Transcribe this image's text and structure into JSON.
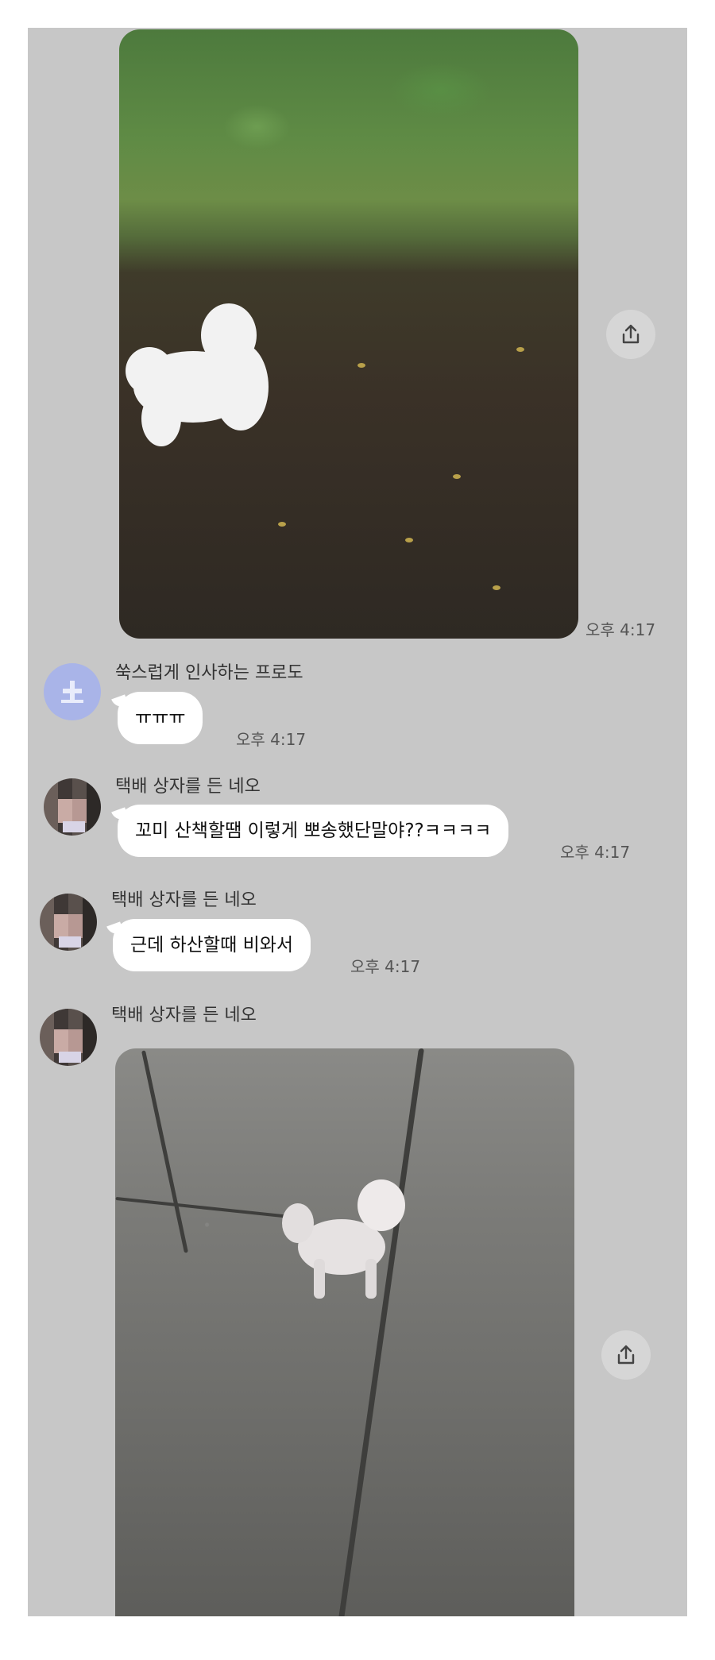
{
  "messages": [
    {
      "type": "photo",
      "time": "오후 4:17"
    },
    {
      "type": "text",
      "sender": "쑥스럽게 인사하는 프로도",
      "text": "ㅠㅠㅠ",
      "time": "오후 4:17"
    },
    {
      "type": "text",
      "sender": "택배 상자를 든 네오",
      "text": "꼬미 산책할땜 이렇게 뽀송했단말야??ㅋㅋㅋㅋ",
      "time": "오후 4:17"
    },
    {
      "type": "text",
      "sender": "택배 상자를 든 네오",
      "text": "근데 하산할때 비와서",
      "time": "오후 4:17"
    },
    {
      "type": "photo",
      "sender": "택배 상자를 든 네오"
    }
  ],
  "icons": {
    "share": "share-upload-icon",
    "avatar_frodo": "frodo-avatar-icon"
  },
  "colors": {
    "background": "#c7c7c7",
    "bubble": "#ffffff",
    "frodo_avatar": "#a9b4e8"
  }
}
